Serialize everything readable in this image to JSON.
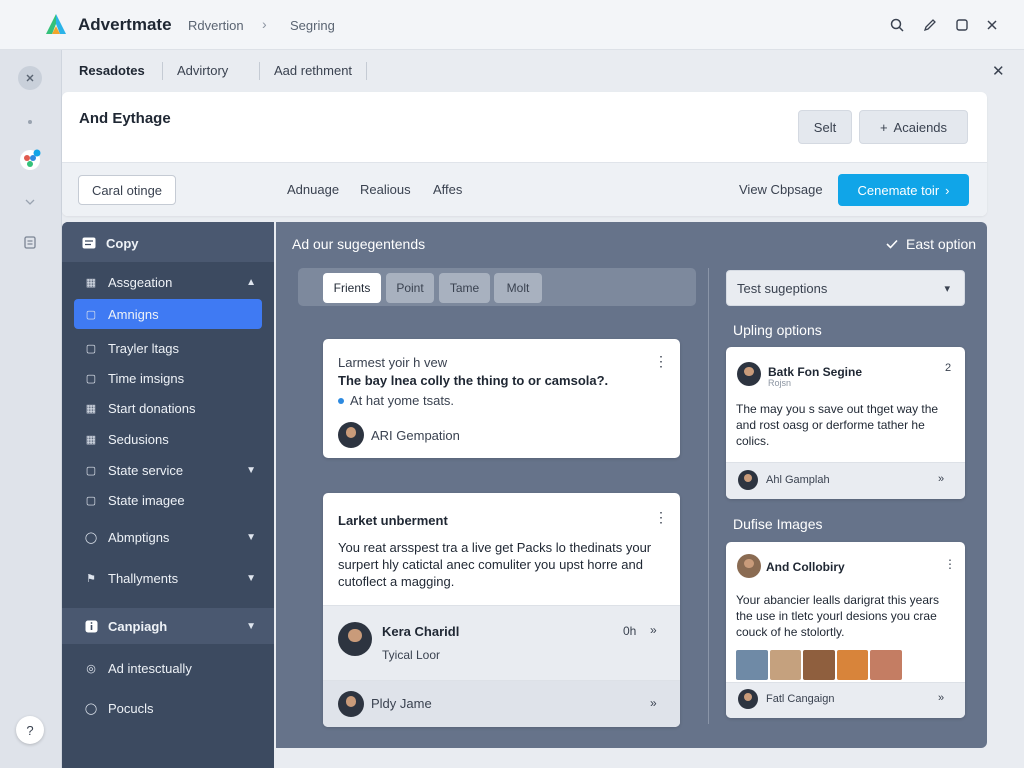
{
  "app": {
    "name": "Advertmate",
    "breadcrumb": [
      "Rdvertion",
      "Segring"
    ],
    "brand_colors": {
      "primary": "#10a5e8",
      "active_nav": "#3f7af3",
      "sidebar": "#3c4a60",
      "content": "#66738a"
    }
  },
  "rail": {
    "icons": [
      "close-icon",
      "dot-icon",
      "team-icon",
      "chevron-down-icon",
      "clipboard-icon"
    ],
    "bottom_label": "?"
  },
  "top_tabs": [
    "Resadotes",
    "Advirtory",
    "Aad rethment"
  ],
  "header": {
    "title": "And Eythage",
    "button_secondary": "Selt",
    "button_add": "Acaiends",
    "outline_button": "Caral otinge",
    "links": [
      "Adnuage",
      "Realious",
      "Affes"
    ],
    "view_link": "View Cbpsage",
    "primary_button": "Cenemate toir"
  },
  "sidebar": {
    "header": "Copy",
    "items": [
      {
        "label": "Assgeation",
        "chevron": "up",
        "icon": "grid-icon"
      },
      {
        "label": "Amnigns",
        "active": true,
        "icon": "document-icon"
      },
      {
        "label": "Trayler ltags",
        "icon": "square-icon"
      },
      {
        "label": "Time imsigns",
        "icon": "square-icon"
      },
      {
        "label": "Start donations",
        "icon": "grid-icon"
      },
      {
        "label": "Sedusions",
        "icon": "grid-icon"
      },
      {
        "label": "State service",
        "chevron": "down",
        "icon": "square-icon"
      },
      {
        "label": "State imagee",
        "icon": "square-icon"
      },
      {
        "label": "Abmptigns",
        "chevron": "down",
        "icon": "circle-icon"
      },
      {
        "label": "Thallyments",
        "chevron": "down",
        "icon": "flag-icon"
      }
    ],
    "section": {
      "label": "Canpiagh",
      "chevron": "down",
      "icon": "info-icon"
    },
    "bottom_items": [
      {
        "label": "Ad intesctually",
        "icon": "target-icon"
      },
      {
        "label": "Pocucls",
        "icon": "circle-icon"
      }
    ]
  },
  "content": {
    "title": "Ad our sugegentends",
    "right_option": "East option",
    "segments": [
      "Frients",
      "Point",
      "Tame",
      "Molt"
    ],
    "card1": {
      "line1": "Larmest yoir h vew",
      "line2": "The bay lnea colly the thing to or camsola?.",
      "bullet": "At hat yome tsats.",
      "author": "ARI Gempation"
    },
    "card2": {
      "title": "Larket unberment",
      "body": "You reat arsspest tra a live get Packs lo thedinats your surpert hly catictal anec comuliter you upst horre and cutoflect a magging.",
      "person_name": "Kera Charidl",
      "person_role": "Tyical Loor",
      "time": "0h",
      "footer_name": "Pldy Jame"
    },
    "right_panel": {
      "select": "Test sugeptions",
      "section1": "Upling options",
      "card1": {
        "title": "Batk Fon Segine",
        "subtitle": "Rojsn",
        "badge": "2",
        "body": "The may you s save out thget way the and rost oasg or derforme tather he colics.",
        "footer": "Ahl Gamplah"
      },
      "section2": "Dufise Images",
      "card2": {
        "title": "And Collobiry",
        "body": "Your abancier lealls darigrat this years the use in tletc yourl desions you crae couck of he stolortly.",
        "footer": "Fatl Cangaign"
      }
    }
  }
}
